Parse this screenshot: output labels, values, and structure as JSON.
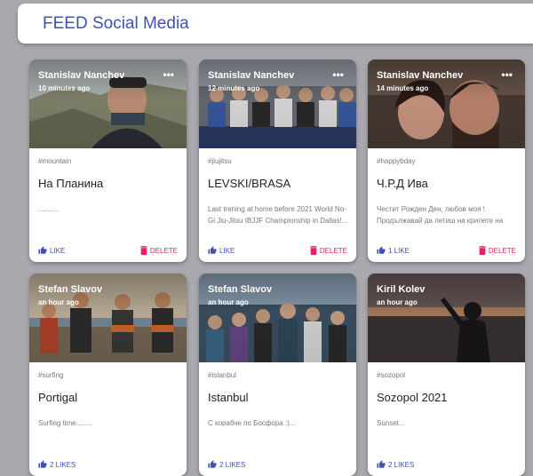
{
  "appbar": {
    "title": "FEED Social Media"
  },
  "icons": {
    "like": "thumb-up-icon",
    "delete": "trash-icon",
    "more": "more-horizontal-icon"
  },
  "colors": {
    "primary": "#3f51b5",
    "delete": "#e91e63",
    "background": "#a9a8ae"
  },
  "posts": [
    {
      "author": "Stanislav Nanchev",
      "time": "10 minutes ago",
      "tag": "#mountain",
      "title": "На Планина",
      "desc": "..........",
      "like": "LIKE",
      "delete": "DELETE"
    },
    {
      "author": "Stanislav Nanchev",
      "time": "12 minutes ago",
      "tag": "#jiujitsu",
      "title": "LEVSKI/BRASA",
      "desc": "Last trening at home before 2021 World No-Gi Jiu-Jitsu IBJJF Championship in Dallas!...",
      "like": "LIKE",
      "delete": "DELETE"
    },
    {
      "author": "Stanislav Nanchev",
      "time": "14 minutes ago",
      "tag": "#happybday",
      "title": "Ч.Р.Д Ива",
      "desc": "Честит Рожден Ден, любов моя ! Продължавай да летиш на крилете на любовта и да правиш света ми смисле н ...",
      "like": "1 LIKE",
      "delete": "DELETE"
    },
    {
      "author": "Stefan Slavov",
      "time": "an hour ago",
      "tag": "#surfing",
      "title": "Portigal",
      "desc": "Surfing time........",
      "like": "2 LIKES"
    },
    {
      "author": "Stefan Slavov",
      "time": "an hour ago",
      "tag": "#istanbul",
      "title": "Istanbul",
      "desc": "С корабче по Босфора :)...",
      "like": "2 LIKES"
    },
    {
      "author": "Kiril Kolev",
      "time": "an hour ago",
      "tag": "#sozopol",
      "title": "Sozopol 2021",
      "desc": "Sunset...",
      "like": "2 LIKES"
    }
  ]
}
